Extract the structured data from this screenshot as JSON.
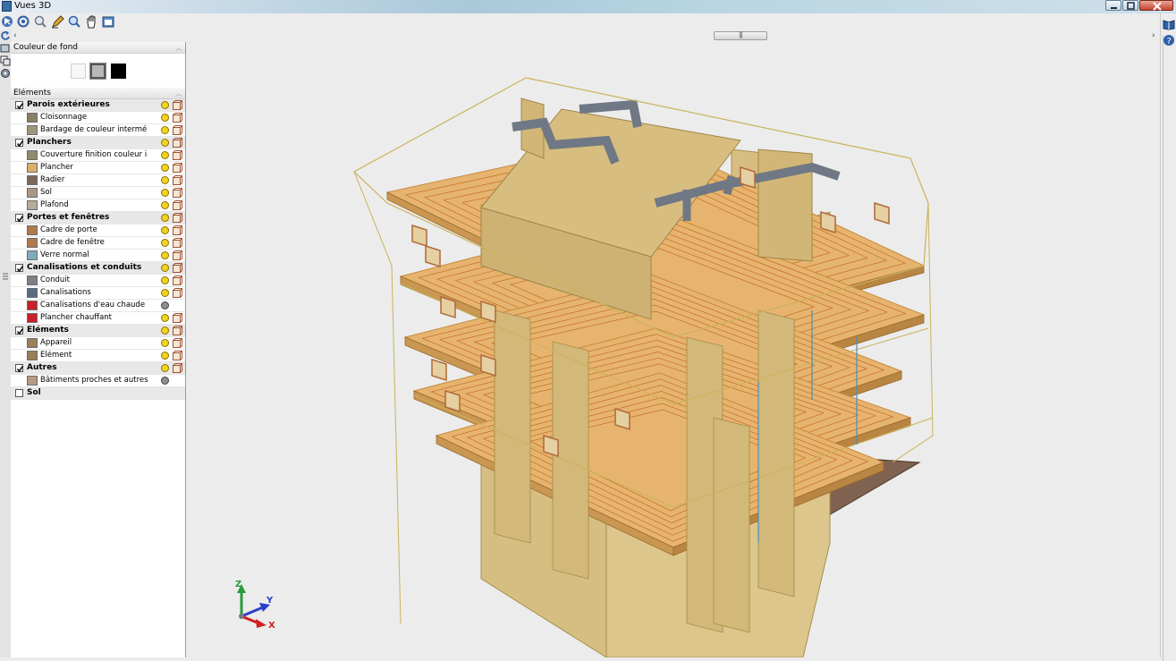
{
  "window": {
    "title": "Vues 3D"
  },
  "panel": {
    "background_header": "Couleur de fond",
    "background_colors": [
      "#f6f6f6",
      "#b8b8b8",
      "#000000"
    ],
    "elements_header": "Eléments",
    "groups": [
      {
        "label": "Parois extérieures",
        "checked": true,
        "items": [
          {
            "label": "Cloisonnage",
            "color": "#8a7f66"
          },
          {
            "label": "Bardage de couleur intermé...",
            "color": "#9d967a"
          }
        ]
      },
      {
        "label": "Planchers",
        "checked": true,
        "items": [
          {
            "label": "Couverture finition couleur in...",
            "color": "#8f8a6c"
          },
          {
            "label": "Plancher",
            "color": "#d8b06a"
          },
          {
            "label": "Radier",
            "color": "#7a6a5a"
          },
          {
            "label": "Sol",
            "color": "#a89885"
          },
          {
            "label": "Plafond",
            "color": "#b7aa98"
          }
        ]
      },
      {
        "label": "Portes et fenêtres",
        "checked": true,
        "items": [
          {
            "label": "Cadre de porte",
            "color": "#b07a4f"
          },
          {
            "label": "Cadre de fenêtre",
            "color": "#b07a4f"
          },
          {
            "label": "Verre normal",
            "color": "#82aabc"
          }
        ]
      },
      {
        "label": "Canalisations et conduits",
        "checked": true,
        "items": [
          {
            "label": "Conduit",
            "color": "#7b7f88"
          },
          {
            "label": "Canalisations",
            "color": "#5a6a80"
          },
          {
            "label": "Canalisations d'eau chaude",
            "color": "#c8202a"
          },
          {
            "label": "Plancher chauffant",
            "color": "#c8202a"
          }
        ]
      },
      {
        "label": "Eléments",
        "checked": true,
        "items": [
          {
            "label": "Appareil",
            "color": "#9a7f5a"
          },
          {
            "label": "Elément",
            "color": "#9a7f5a"
          }
        ]
      },
      {
        "label": "Autres",
        "checked": true,
        "items": [
          {
            "label": "Bâtiments proches et autres...",
            "color": "#b79a82"
          }
        ]
      },
      {
        "label": "Sol",
        "checked": false,
        "items": []
      }
    ]
  },
  "viewport": {
    "axis_labels": {
      "z": "Z",
      "y": "Y",
      "x": "X"
    }
  },
  "colors": {
    "slab": "#e6b46e",
    "wall": "#d6bd82",
    "outline": "#c9b35a",
    "duct": "#6f7884",
    "ground": "#806250"
  }
}
